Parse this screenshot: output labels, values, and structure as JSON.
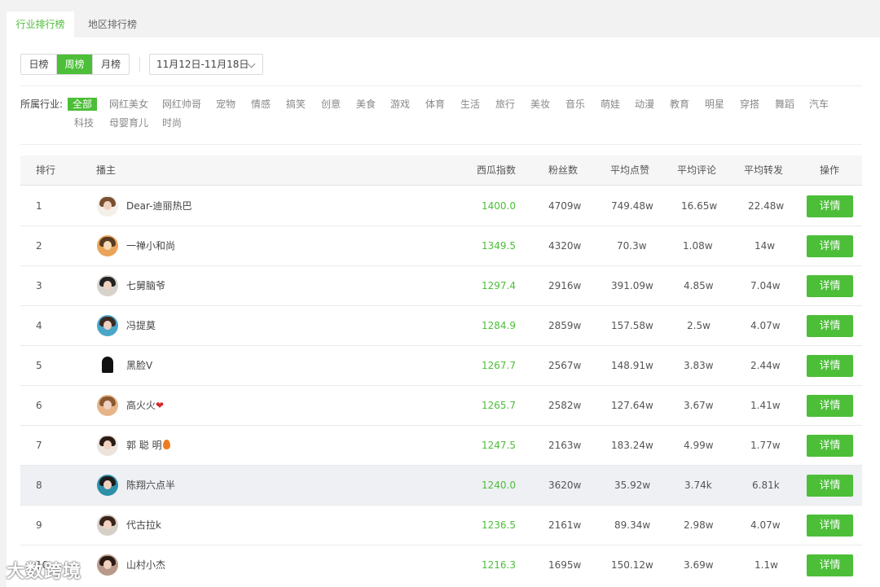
{
  "tabs": [
    {
      "label": "行业排行榜",
      "active": true
    },
    {
      "label": "地区排行榜",
      "active": false
    }
  ],
  "period": {
    "options": [
      "日榜",
      "周榜",
      "月榜"
    ],
    "selected": "周榜",
    "date_range": "11月12日-11月18日"
  },
  "industry": {
    "label": "所属行业:",
    "items": [
      "全部",
      "网红美女",
      "网红帅哥",
      "宠物",
      "情感",
      "搞笑",
      "创意",
      "美食",
      "游戏",
      "体育",
      "生活",
      "旅行",
      "美妆",
      "音乐",
      "萌娃",
      "动漫",
      "教育",
      "明星",
      "穿搭",
      "舞蹈",
      "汽车",
      "科技",
      "母婴育儿",
      "时尚"
    ],
    "selected": "全部"
  },
  "table": {
    "headers": [
      "排行",
      "播主",
      "西瓜指数",
      "粉丝数",
      "平均点赞",
      "平均评论",
      "平均转发",
      "操作"
    ],
    "action_label": "详情",
    "rows": [
      {
        "rank": "1",
        "name": "Dear-迪丽热巴",
        "score": "1400.0",
        "fans": "4709w",
        "likes": "749.48w",
        "comments": "16.65w",
        "shares": "22.48w"
      },
      {
        "rank": "2",
        "name": "一禅小和尚",
        "score": "1349.5",
        "fans": "4320w",
        "likes": "70.3w",
        "comments": "1.08w",
        "shares": "14w"
      },
      {
        "rank": "3",
        "name": "七舅脑爷",
        "score": "1297.4",
        "fans": "2916w",
        "likes": "391.09w",
        "comments": "4.85w",
        "shares": "7.04w"
      },
      {
        "rank": "4",
        "name": "冯提莫",
        "score": "1284.9",
        "fans": "2859w",
        "likes": "157.58w",
        "comments": "2.5w",
        "shares": "4.07w"
      },
      {
        "rank": "5",
        "name": "黑脸V",
        "score": "1267.7",
        "fans": "2567w",
        "likes": "148.91w",
        "comments": "3.83w",
        "shares": "2.44w"
      },
      {
        "rank": "6",
        "name": "高火火",
        "score": "1265.7",
        "fans": "2582w",
        "likes": "127.64w",
        "comments": "3.67w",
        "shares": "1.41w"
      },
      {
        "rank": "7",
        "name": "郭 聪 明",
        "score": "1247.5",
        "fans": "2163w",
        "likes": "183.24w",
        "comments": "4.99w",
        "shares": "1.77w"
      },
      {
        "rank": "8",
        "name": "陈翔六点半",
        "score": "1240.0",
        "fans": "3620w",
        "likes": "35.92w",
        "comments": "3.74k",
        "shares": "6.81k"
      },
      {
        "rank": "9",
        "name": "代古拉k",
        "score": "1236.5",
        "fans": "2161w",
        "likes": "89.34w",
        "comments": "2.98w",
        "shares": "4.07w"
      },
      {
        "rank": "10",
        "name": "山村小杰",
        "score": "1216.3",
        "fans": "1695w",
        "likes": "150.12w",
        "comments": "3.69w",
        "shares": "1.1w"
      }
    ]
  },
  "watermark": "大数跨境",
  "colors": {
    "accent": "#4cbe38"
  }
}
